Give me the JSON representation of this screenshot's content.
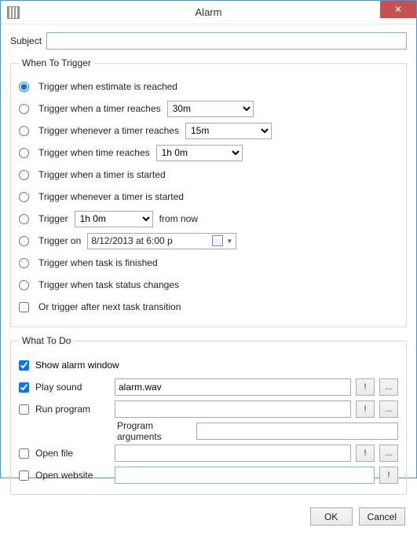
{
  "window": {
    "title": "Alarm",
    "close_glyph": "✕"
  },
  "subject": {
    "label": "Subject",
    "value": ""
  },
  "trigger_group": {
    "legend": "When To Trigger",
    "opt_estimate": "Trigger when estimate is reached",
    "opt_timer_reaches": "Trigger when a timer reaches",
    "timer_reaches_val": "30m",
    "opt_whenever_reaches": "Trigger whenever a timer reaches",
    "whenever_reaches_val": "15m",
    "opt_time_reaches": "Trigger when time reaches",
    "time_reaches_val": "1h 0m",
    "opt_timer_started": "Trigger when a timer is started",
    "opt_whenever_started": "Trigger whenever a timer is started",
    "opt_fromnow_pre": "Trigger",
    "fromnow_val": "1h 0m",
    "opt_fromnow_post": "from now",
    "opt_triggeron": "Trigger on",
    "triggeron_val": "8/12/2013 at   6:00 p",
    "opt_task_finished": "Trigger when task is finished",
    "opt_status_changes": "Trigger when task status changes",
    "opt_after_transition": "Or trigger after next task transition"
  },
  "action_group": {
    "legend": "What To Do",
    "show_window": "Show alarm window",
    "play_sound": "Play sound",
    "play_sound_val": "alarm.wav",
    "run_program": "Run program",
    "run_program_val": "",
    "program_args_label": "Program arguments",
    "program_args_val": "",
    "open_file": "Open file",
    "open_file_val": "",
    "open_website": "Open website",
    "open_website_val": "",
    "bang": "!",
    "dots": "..."
  },
  "buttons": {
    "ok": "OK",
    "cancel": "Cancel"
  }
}
